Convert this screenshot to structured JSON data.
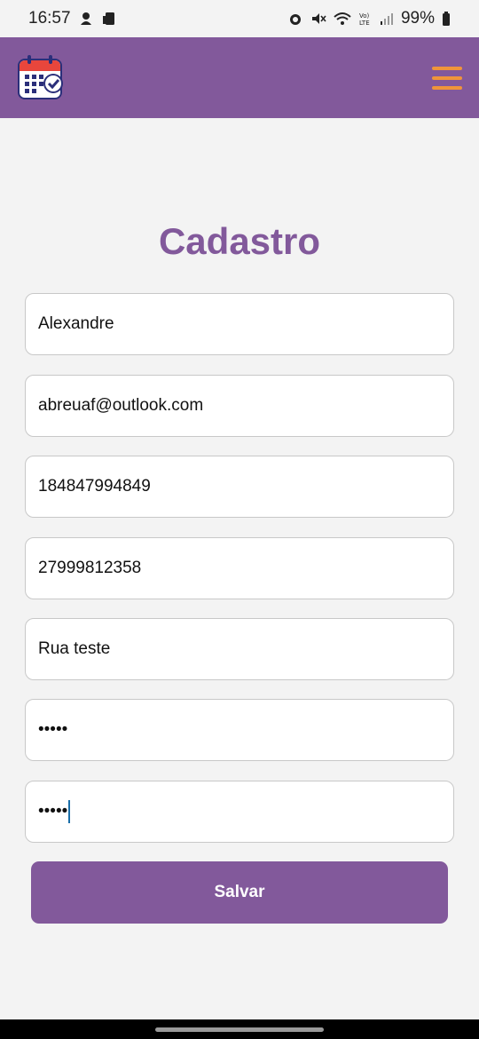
{
  "status_bar": {
    "time": "16:57",
    "battery": "99%",
    "left_icons": [
      "notification-icon",
      "device-icon"
    ],
    "right_icons": [
      "alarm-icon",
      "mute-icon",
      "wifi-icon",
      "volte-icon",
      "signal-icon",
      "battery-icon"
    ]
  },
  "header": {
    "logo_icon": "calendar-check-icon",
    "menu_icon": "hamburger-menu-icon",
    "bg_color": "#82599b",
    "menu_color": "#f0953a"
  },
  "page": {
    "title": "Cadastro"
  },
  "form": {
    "fields": [
      {
        "name": "name-field",
        "value": "Alexandre"
      },
      {
        "name": "email-field",
        "value": "abreuaf@outlook.com"
      },
      {
        "name": "document-field",
        "value": "184847994849"
      },
      {
        "name": "phone-field",
        "value": "27999812358"
      },
      {
        "name": "address-field",
        "value": "Rua teste"
      },
      {
        "name": "password-field",
        "value": "•••••"
      },
      {
        "name": "confirm-password-field",
        "value": "•••••"
      }
    ],
    "submit_label": "Salvar"
  }
}
